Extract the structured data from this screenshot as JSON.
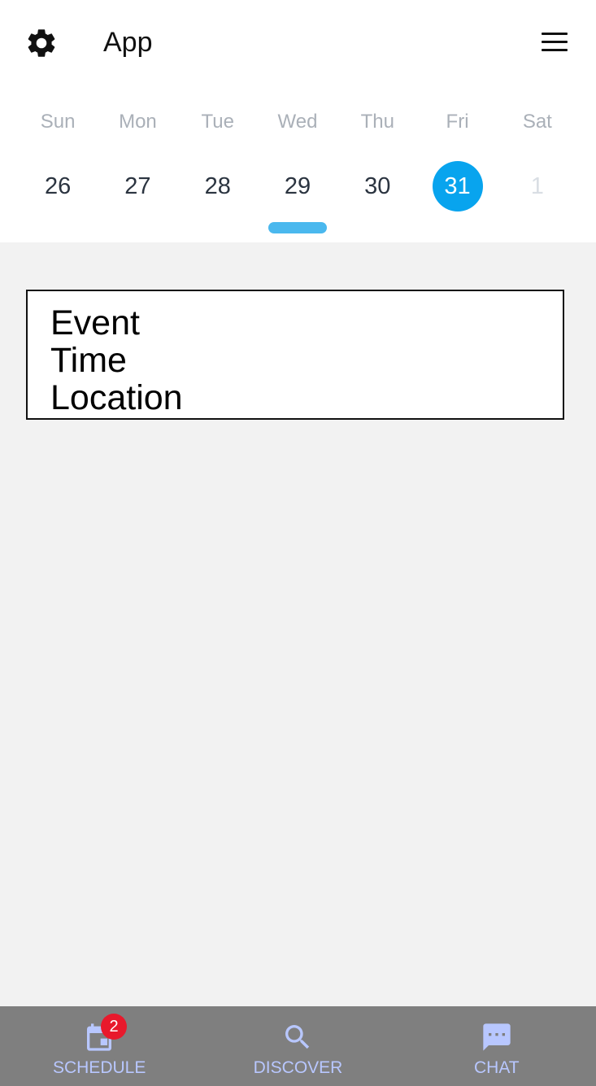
{
  "header": {
    "title": "App",
    "settings_icon": "gear-icon",
    "menu_icon": "hamburger-menu-icon"
  },
  "calendar": {
    "days": [
      {
        "dow": "Sun",
        "date": "26"
      },
      {
        "dow": "Mon",
        "date": "27"
      },
      {
        "dow": "Tue",
        "date": "28"
      },
      {
        "dow": "Wed",
        "date": "29"
      },
      {
        "dow": "Thu",
        "date": "30"
      },
      {
        "dow": "Fri",
        "date": "31",
        "selected": true
      },
      {
        "dow": "Sat",
        "date": "1",
        "faded": true
      }
    ],
    "selected_color": "#08a4ee",
    "indicator_color": "#4ab8ee"
  },
  "event_card": {
    "event": "Event",
    "time": "Time",
    "location": "Location"
  },
  "tabbar": {
    "tabs": [
      {
        "label": "SCHEDULE",
        "icon": "calendar-icon",
        "badge": "2"
      },
      {
        "label": "DISCOVER",
        "icon": "search-icon"
      },
      {
        "label": "CHAT",
        "icon": "chat-icon"
      }
    ],
    "label_color": "#b8c7ff",
    "badge_color": "#e8192c"
  }
}
